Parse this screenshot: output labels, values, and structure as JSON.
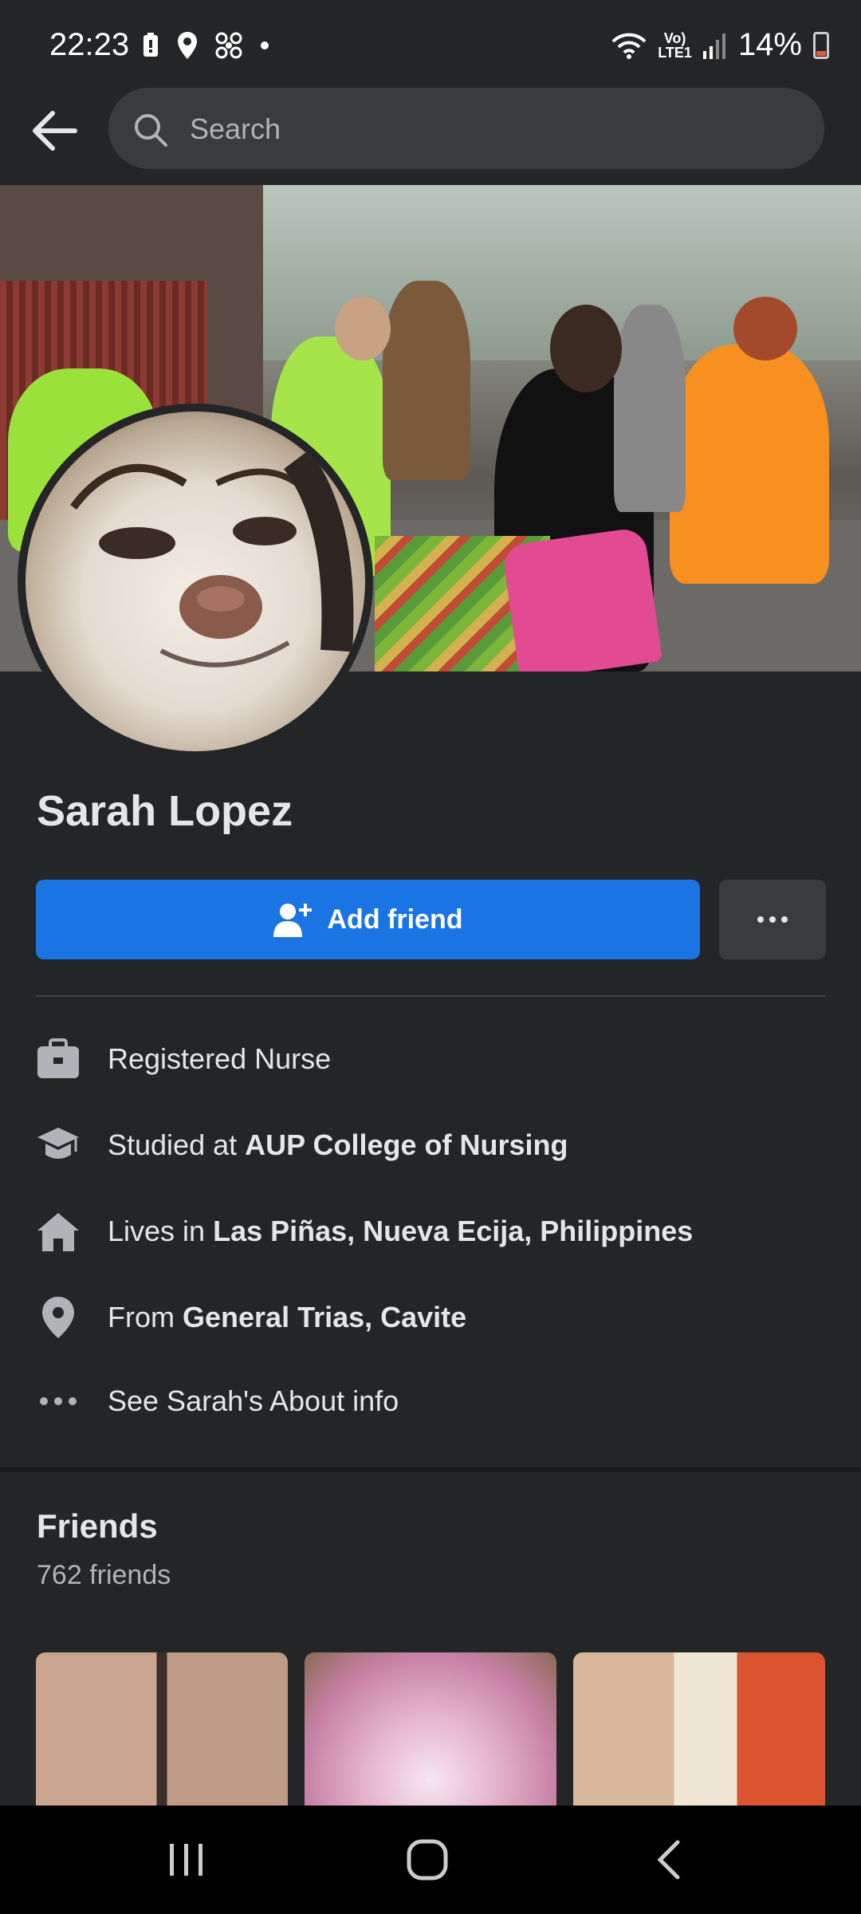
{
  "status_bar": {
    "time": "22:23",
    "network_label_top": "Vo)",
    "network_label_bottom": "LTE1",
    "battery": "14%"
  },
  "search": {
    "placeholder": "Search"
  },
  "profile": {
    "name": "Sarah Lopez",
    "add_friend_label": "Add friend"
  },
  "details": {
    "work": {
      "text": "Registered Nurse"
    },
    "education": {
      "prefix": "Studied at ",
      "bold": "AUP College of Nursing"
    },
    "lives": {
      "prefix": "Lives in ",
      "bold": "Las Piñas, Nueva Ecija, Philippines"
    },
    "from": {
      "prefix": "From ",
      "bold": "General Trias, Cavite"
    },
    "about": {
      "text": "See Sarah's About info"
    }
  },
  "friends": {
    "title": "Friends",
    "count": "762 friends"
  },
  "colors": {
    "accent": "#1b74e4",
    "background": "#242526",
    "secondary_button": "#3a3b3c"
  }
}
